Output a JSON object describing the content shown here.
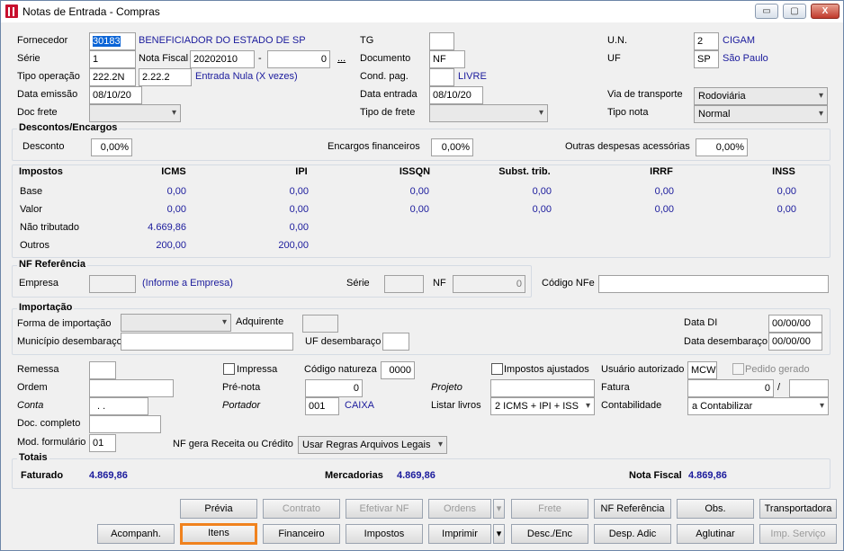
{
  "window": {
    "title": "Notas de Entrada - Compras",
    "min": "▭",
    "max": "▢",
    "close": "X"
  },
  "header": {
    "fornecedor_label": "Fornecedor",
    "fornecedor_code": "30183",
    "fornecedor_name": "BENEFICIADOR DO ESTADO DE SP",
    "serie_label": "Série",
    "serie": "1",
    "nota_fiscal_label": "Nota Fiscal",
    "nota_fiscal": "20202010",
    "dash": "-",
    "nota_fiscal_suffix": "0",
    "ellipsis": "...",
    "tipo_op_label": "Tipo operação",
    "tipo_op_1": "222.2N",
    "tipo_op_2": "2.22.2",
    "tipo_op_desc": "Entrada Nula (X vezes)",
    "data_emissao_label": "Data emissão",
    "data_emissao": "08/10/20",
    "doc_frete_label": "Doc frete",
    "doc_frete": "",
    "tg_label": "TG",
    "tg": "",
    "documento_label": "Documento",
    "documento": "NF",
    "cond_pag_label": "Cond. pag.",
    "cond_pag": "",
    "cond_pag_desc": "LIVRE",
    "data_entrada_label": "Data entrada",
    "data_entrada": "08/10/20",
    "tipo_frete_label": "Tipo de frete",
    "tipo_frete": "",
    "un_label": "U.N.",
    "un": "2",
    "un_desc": "CIGAM",
    "uf_label": "UF",
    "uf": "SP",
    "uf_desc": "São Paulo",
    "via_label": "Via de transporte",
    "via": "Rodoviária",
    "tipo_nota_label": "Tipo nota",
    "tipo_nota": "Normal"
  },
  "descontos": {
    "title": "Descontos/Encargos",
    "desconto_label": "Desconto",
    "desconto": "0,00%",
    "encargos_label": "Encargos financeiros",
    "encargos": "0,00%",
    "outras_label": "Outras despesas acessórias",
    "outras": "0,00%"
  },
  "impostos": {
    "title": "Impostos",
    "columns": [
      "ICMS",
      "IPI",
      "ISSQN",
      "Subst. trib.",
      "IRRF",
      "INSS"
    ],
    "rows": [
      {
        "label": "Base",
        "values": [
          "0,00",
          "0,00",
          "0,00",
          "0,00",
          "0,00",
          "0,00"
        ]
      },
      {
        "label": "Valor",
        "values": [
          "0,00",
          "0,00",
          "0,00",
          "0,00",
          "0,00",
          "0,00"
        ]
      },
      {
        "label": "Não tributado",
        "values": [
          "4.669,86",
          "0,00",
          "",
          "",
          "",
          ""
        ]
      },
      {
        "label": "Outros",
        "values": [
          "200,00",
          "200,00",
          "",
          "",
          "",
          ""
        ]
      }
    ]
  },
  "nf_ref": {
    "title": "NF Referência",
    "empresa_label": "Empresa",
    "empresa": "",
    "empresa_hint": "(Informe a Empresa)",
    "serie_label": "Série",
    "serie": "",
    "nf_label": "NF",
    "nf": "0",
    "codigo_label": "Código NFe",
    "codigo": ""
  },
  "importacao": {
    "title": "Importação",
    "forma_label": "Forma de importação",
    "forma": "",
    "adquirente_label": "Adquirente",
    "adquirente": "",
    "municipio_label": "Município desembaraço",
    "municipio": "",
    "uf_label": "UF desembaraço",
    "uf": "",
    "data_di_label": "Data DI",
    "data_di": "00/00/00",
    "data_desemb_label": "Data desembaraço",
    "data_desemb": "00/00/00"
  },
  "misc": {
    "remessa_label": "Remessa",
    "remessa": "",
    "impressa_label": "Impressa",
    "codigo_nat_label": "Código natureza",
    "codigo_nat": "0000",
    "impostos_aj_label": "Impostos ajustados",
    "usuario_label": "Usuário autorizado",
    "usuario": "MCW",
    "pedido_label": "Pedido gerado",
    "ordem_label": "Ordem",
    "ordem": "",
    "prenota_label": "Pré-nota",
    "prenota": "0",
    "projeto_label": "Projeto",
    "projeto": "",
    "fatura_label": "Fatura",
    "fatura": "0",
    "fatura_sep": "/",
    "fatura_2": "",
    "conta_label": "Conta",
    "conta": ". .",
    "portador_label": "Portador",
    "portador": "001",
    "portador_desc": "CAIXA",
    "listar_label": "Listar livros",
    "listar": "2 ICMS + IPI + ISS",
    "contab_label": "Contabilidade",
    "contab": "a Contabilizar",
    "doc_completo_label": "Doc. completo",
    "doc_completo": "",
    "mod_label": "Mod. formulário",
    "mod": "01",
    "nf_receita_label": "NF gera Receita ou Crédito",
    "nf_receita": "Usar Regras Arquivos Legais"
  },
  "totais": {
    "title": "Totais",
    "faturado_label": "Faturado",
    "faturado": "4.869,86",
    "mercadorias_label": "Mercadorias",
    "mercadorias": "4.869,86",
    "nota_label": "Nota Fiscal",
    "nota": "4.869,86"
  },
  "buttons_row1": [
    "Prévia",
    "Contrato",
    "Efetivar NF",
    "Ordens",
    "Frete",
    "NF Referência",
    "Obs.",
    "Transportadora"
  ],
  "buttons_row2": [
    "Acompanh.",
    "Itens",
    "Financeiro",
    "Impostos",
    "Imprimir",
    "Desc./Enc",
    "Desp. Adic",
    "Aglutinar",
    "Imp. Serviço"
  ],
  "dropdown_arrow": "▾"
}
